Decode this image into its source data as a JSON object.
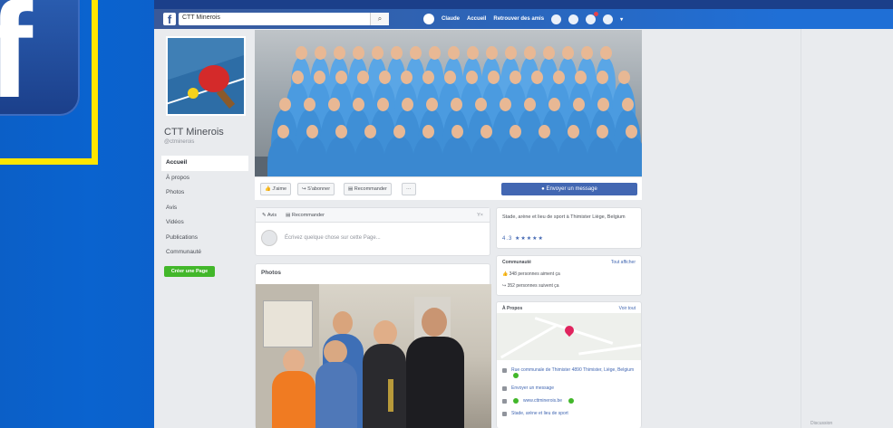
{
  "brand": {
    "logo_letter": "f"
  },
  "topbar": {
    "search_value": "CTT Minerois",
    "search_icon": "magnifier-icon",
    "user_label": "Claude",
    "home_label": "Accueil",
    "find_friends_label": "Retrouver des amis"
  },
  "page": {
    "name": "CTT Minerois",
    "handle": "@ctminerois",
    "menu": [
      "Accueil",
      "À propos",
      "Photos",
      "Avis",
      "Vidéos",
      "Publications",
      "Communauté"
    ],
    "create_page_label": "Créer une Page"
  },
  "actions": {
    "like": "J'aime",
    "follow": "S'abonner",
    "recommend": "Recommander",
    "more": "···",
    "send_message": "Envoyer un message"
  },
  "composer": {
    "tab_post": "Avis",
    "tab_recommend": "Recommander",
    "close": "Y×",
    "placeholder": "Écrivez quelque chose sur cette Page..."
  },
  "photos": {
    "title": "Photos"
  },
  "about": {
    "text": "Stade, arène et lieu de sport à Thimister Liège, Belgium",
    "rating": "4.3 ★★★★★"
  },
  "community": {
    "title": "Communauté",
    "see_all": "Tout afficher",
    "likes": "348 personnes aiment ça",
    "follows": "352 personnes suivent ça"
  },
  "info": {
    "title": "À Propos",
    "see_all": "Voir tout",
    "address": "Rue communale de Thimister 4890 Thimister, Liège, Belgium",
    "send_message": "Envoyer un message",
    "website": "www.cttminerois.be",
    "category": "Stade, arène et lieu de sport"
  },
  "chat": {
    "label": "Discussion"
  },
  "colors": {
    "fb_blue": "#3b5998",
    "button_blue": "#4267b2",
    "green": "#42b72a",
    "highlight": "#ffe600"
  }
}
